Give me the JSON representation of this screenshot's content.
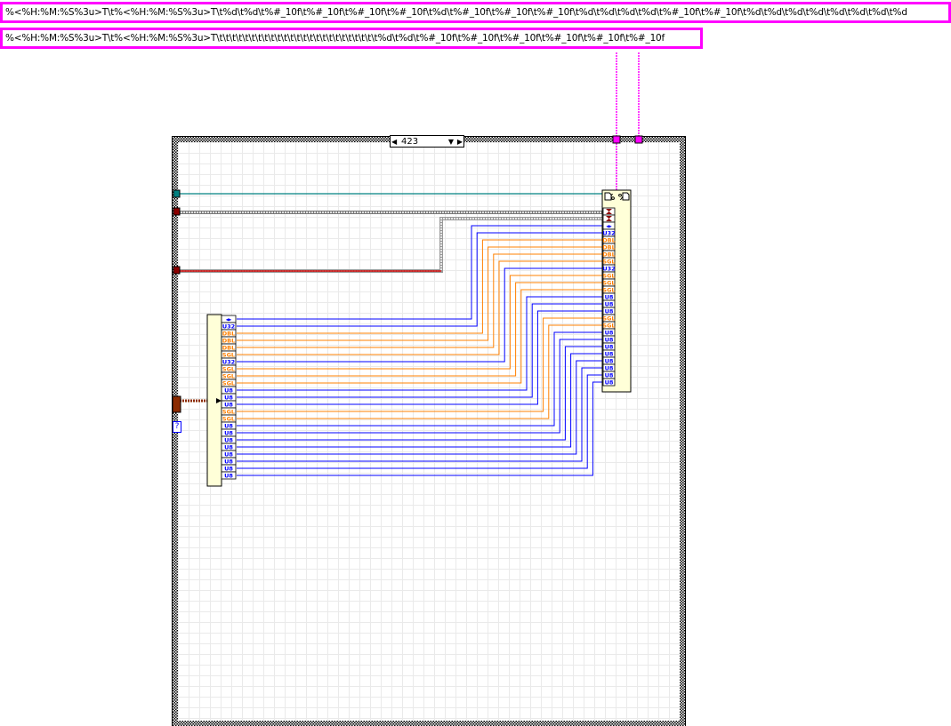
{
  "format_strings": [
    "%<%H:%M:%S%3u>T\\t%<%H:%M:%S%3u>T\\t%d\\t%d\\t%#_10f\\t%#_10f\\t%#_10f\\t%#_10f\\t%d\\t%#_10f\\t%#_10f\\t%#_10f\\t%d\\t%d\\t%d\\t%d\\t%#_10f\\t%#_10f\\t%d\\t%d\\t%d\\t%d\\t%d\\t%d\\t%d\\t%d",
    "%<%H:%M:%S%3u>T\\t%<%H:%M:%S%3u>T\\t\\t\\t\\t\\t\\t\\t\\t\\t\\t\\t\\t\\t\\t\\t\\t\\t\\t\\t\\t\\t\\t\\t\\t\\t%d\\t%d\\t%#_10f\\t%#_10f\\t%#_10f\\t%#_10f\\t%#_10f\\t%#_10f"
  ],
  "case_selector": {
    "value": "423"
  },
  "unbundle_terminals": [
    "◂▸",
    "U32",
    "DBL",
    "DBL",
    "DBL",
    "SGL",
    "U32",
    "SGL",
    "SGL",
    "SGL",
    "U8",
    "U8",
    "U8",
    "SGL",
    "SGL",
    "U8",
    "U8",
    "U8",
    "U8",
    "U8",
    "U8",
    "U8",
    "U8"
  ],
  "format_node": {
    "header": "% ",
    "timestamp_inputs": 2
  },
  "unknown_tunnel": "?",
  "colors": {
    "int": "#0000ff",
    "float": "#ff8000",
    "string": "#ff00ff",
    "error": "#008080",
    "cluster": "#8b2a00"
  }
}
